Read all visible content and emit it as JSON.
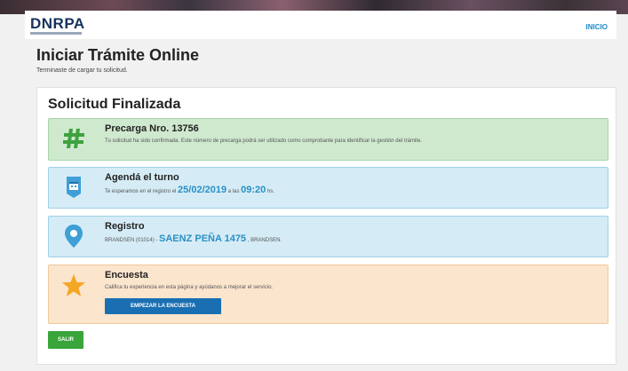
{
  "header": {
    "logo": "DNRPA",
    "nav_inicio": "INICIO"
  },
  "page": {
    "title": "Iniciar Trámite Online",
    "subtitle": "Terminaste de cargar tu solicitud."
  },
  "card": {
    "title": "Solicitud Finalizada",
    "precarga": {
      "heading": "Precarga Nro. 13756",
      "text": "Tu solicitud ha sido confirmada. Este número de precarga podrá ser utilizado como comprobante para identificar la gestión del trámite."
    },
    "turno": {
      "heading": "Agendá el turno",
      "text_prefix": "Te esperamos en el registro el",
      "date": "25/02/2019",
      "text_middle": "a las",
      "time": "09:20",
      "text_suffix": "hs."
    },
    "registro": {
      "heading": "Registro",
      "location": "BRANDSEN (01014) -",
      "address": "SAENZ PEÑA 1475",
      "city": ", BRANDSEN."
    },
    "encuesta": {
      "heading": "Encuesta",
      "text": "Califica tu experiencia en esta página y ayúdanos a mejorar el servicio.",
      "button": "EMPEZAR LA ENCUESTA"
    },
    "salir_button": "SALIR"
  },
  "icons": {
    "precarga": "hash-icon",
    "turno": "calendar-badge-icon",
    "registro": "location-pin-icon",
    "encuesta": "star-icon"
  },
  "colors": {
    "accent_blue": "#1a6fb3",
    "value_blue": "#2a8fc4",
    "success_green": "#3aa53a",
    "hash_green": "#3fa23f",
    "star_orange": "#f5a623"
  }
}
